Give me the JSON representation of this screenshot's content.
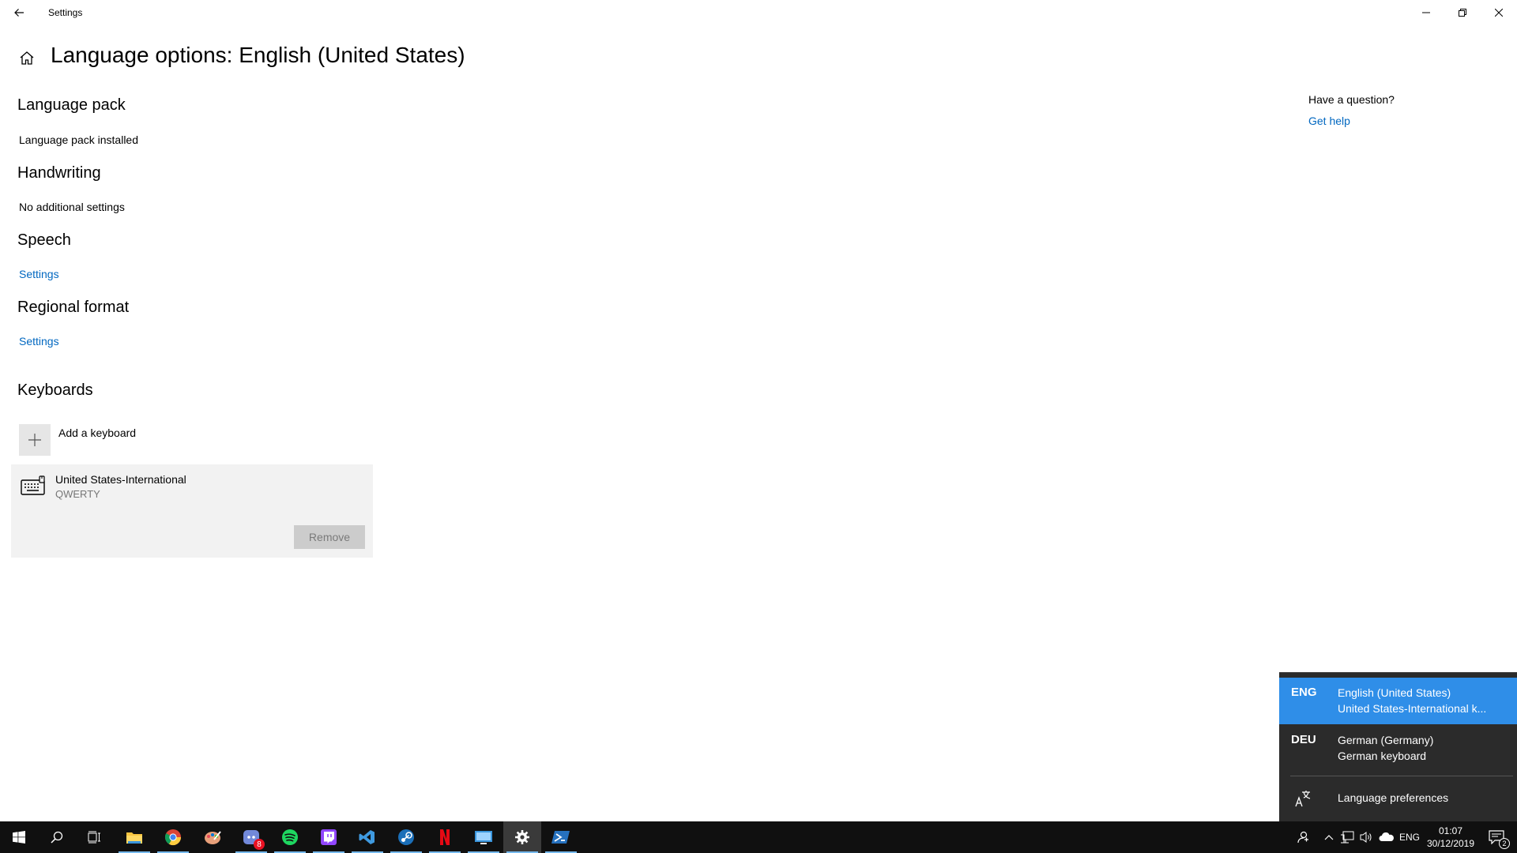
{
  "window": {
    "title": "Settings"
  },
  "page": {
    "title": "Language options: English (United States)"
  },
  "sections": {
    "language_pack": {
      "heading": "Language pack",
      "text": "Language pack installed"
    },
    "handwriting": {
      "heading": "Handwriting",
      "text": "No additional settings"
    },
    "speech": {
      "heading": "Speech",
      "link": "Settings"
    },
    "regional_format": {
      "heading": "Regional format",
      "link": "Settings"
    },
    "keyboards": {
      "heading": "Keyboards",
      "add_label": "Add a keyboard",
      "items": [
        {
          "name": "United States-International",
          "layout": "QWERTY",
          "remove_label": "Remove"
        }
      ]
    }
  },
  "help": {
    "question": "Have a question?",
    "link": "Get help"
  },
  "language_flyout": {
    "items": [
      {
        "code": "ENG",
        "name": "English (United States)",
        "keyboard": "United States-International k...",
        "active": true
      },
      {
        "code": "DEU",
        "name": "German (Germany)",
        "keyboard": "German keyboard",
        "active": false
      }
    ],
    "preferences_label": "Language preferences"
  },
  "taskbar": {
    "apps": [
      "start-icon",
      "search-icon",
      "task-view-icon",
      "file-explorer-icon",
      "chrome-icon",
      "paint-3d-icon",
      "discord-icon",
      "spotify-icon",
      "twitch-icon",
      "visual-studio-icon",
      "steam-icon",
      "netflix-icon",
      "remote-desktop-icon",
      "settings-icon",
      "powershell-icon"
    ],
    "discord_badge": "8",
    "tray": {
      "input_indicator": "ENG",
      "time": "01:07",
      "date": "30/12/2019",
      "notification_count": "2"
    }
  },
  "colors": {
    "accent": "#0067c0",
    "flyout_active": "#2f8ee8",
    "taskbar": "#101010"
  }
}
